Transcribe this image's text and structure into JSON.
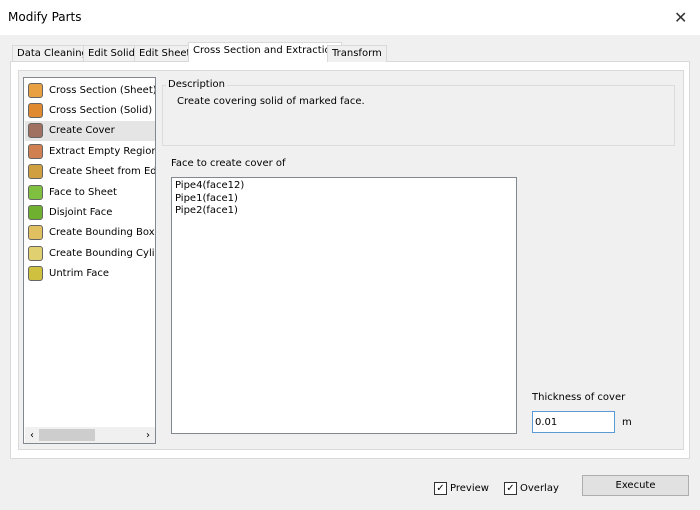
{
  "window": {
    "title": "Modify Parts"
  },
  "tabs": [
    {
      "label": "Data Cleaning"
    },
    {
      "label": "Edit Solid"
    },
    {
      "label": "Edit Sheet"
    },
    {
      "label": "Cross Section and Extraction"
    },
    {
      "label": "Transform"
    }
  ],
  "tools": [
    {
      "label": "Cross Section (Sheet)",
      "icon": "cross-section-sheet-icon",
      "color": "#e8a040"
    },
    {
      "label": "Cross Section (Solid)",
      "icon": "cross-section-solid-icon",
      "color": "#e08a30"
    },
    {
      "label": "Create Cover",
      "icon": "create-cover-icon",
      "color": "#a07060"
    },
    {
      "label": "Extract Empty Regions o",
      "icon": "extract-empty-regions-icon",
      "color": "#d08050"
    },
    {
      "label": "Create Sheet from Edge",
      "icon": "sheet-from-edge-icon",
      "color": "#d0a040"
    },
    {
      "label": "Face to Sheet",
      "icon": "face-to-sheet-icon",
      "color": "#80c040"
    },
    {
      "label": "Disjoint Face",
      "icon": "disjoint-face-icon",
      "color": "#70b030"
    },
    {
      "label": "Create Bounding Box (A",
      "icon": "bounding-box-icon",
      "color": "#e0c060"
    },
    {
      "label": "Create Bounding Cylinde",
      "icon": "bounding-cylinder-icon",
      "color": "#e0d070"
    },
    {
      "label": "Untrim Face",
      "icon": "untrim-face-icon",
      "color": "#d0c040"
    }
  ],
  "description": {
    "label": "Description",
    "text": "Create covering solid of marked face."
  },
  "faces": {
    "label": "Face to create cover of",
    "items": [
      "Pipe4(face12)",
      "Pipe1(face1)",
      "Pipe2(face1)"
    ]
  },
  "thickness": {
    "label": "Thickness of cover",
    "value": "0.01",
    "unit": "m"
  },
  "footer": {
    "preview": "Preview",
    "overlay": "Overlay",
    "execute": "Execute"
  }
}
